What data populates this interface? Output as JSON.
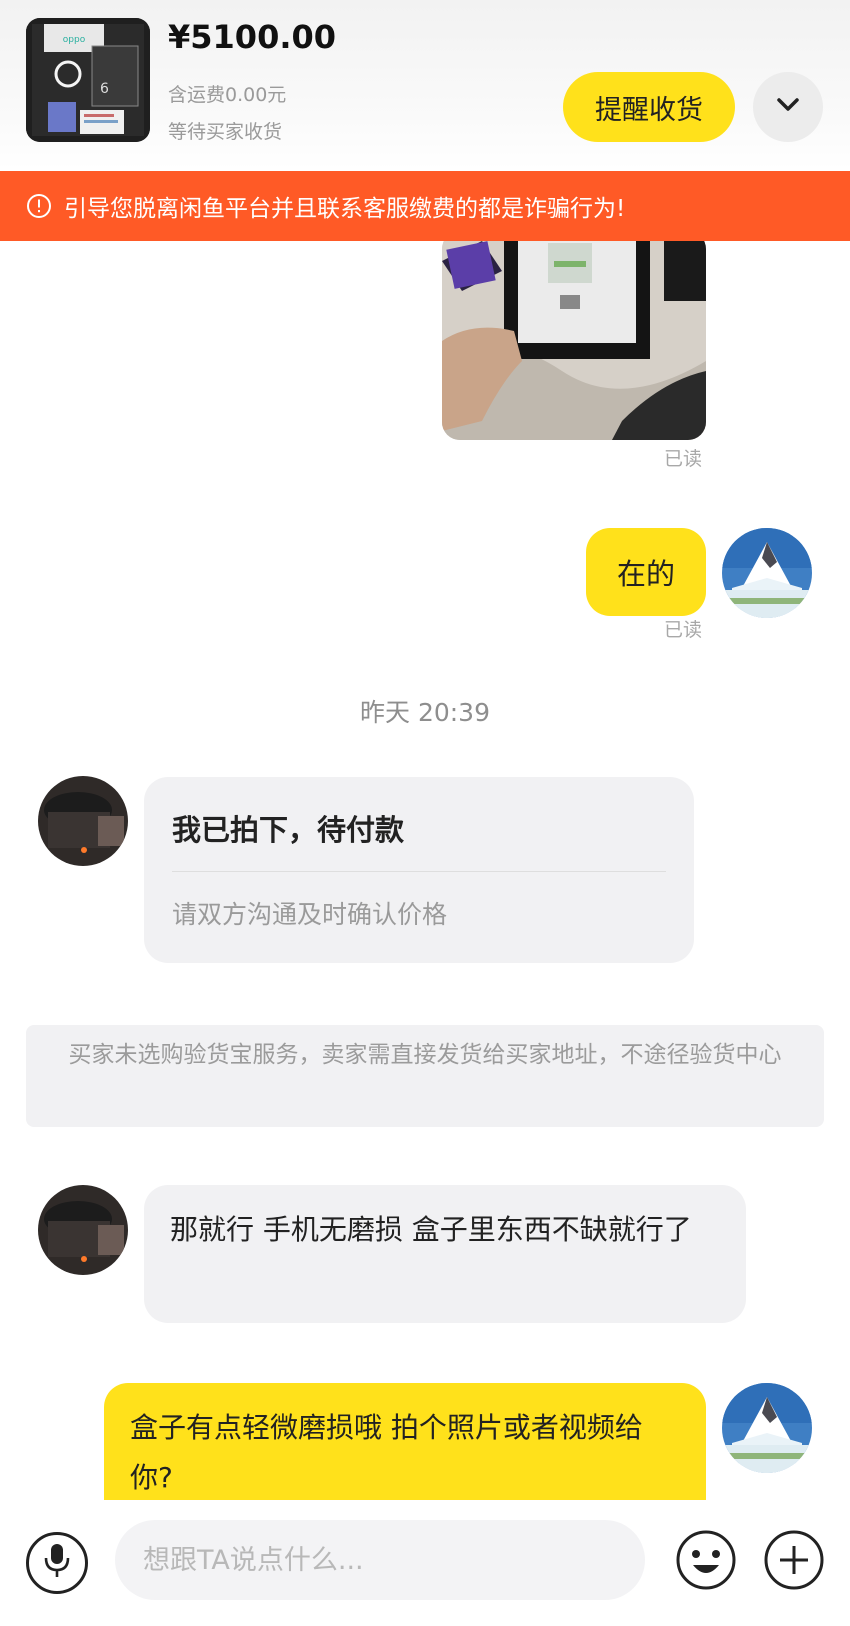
{
  "header": {
    "price": "¥5100.00",
    "shipping": "含运费0.00元",
    "status": "等待买家收货",
    "remind_button": "提醒收货",
    "expand_icon": "chevron-down-icon"
  },
  "warning": {
    "text": "引导您脱离闲鱼平台并且联系客服缴费的都是诈骗行为!",
    "icon": "alert-circle-icon"
  },
  "messages": {
    "read_label_1": "已读",
    "seller_reply": "在的",
    "read_label_2": "已读",
    "timestamp": "昨天 20:39",
    "order_card": {
      "title": "我已拍下，待付款",
      "subtitle": "请双方沟通及时确认价格"
    },
    "system_note": "买家未选购验货宝服务，卖家需直接发货给买家地址，不途径验货中心",
    "buyer_message": "那就行 手机无磨损 盒子里东西不缺就行了",
    "seller_message": "盒子有点轻微磨损哦 拍个照片或者视频给你?"
  },
  "input_bar": {
    "placeholder": "想跟TA说点什么...",
    "mic_icon": "microphone-icon",
    "emoji_icon": "smiley-icon",
    "plus_icon": "plus-circle-icon"
  },
  "colors": {
    "accent_yellow": "#ffe11b",
    "warning_orange": "#ff5a26",
    "bubble_gray": "#f1f1f3"
  }
}
